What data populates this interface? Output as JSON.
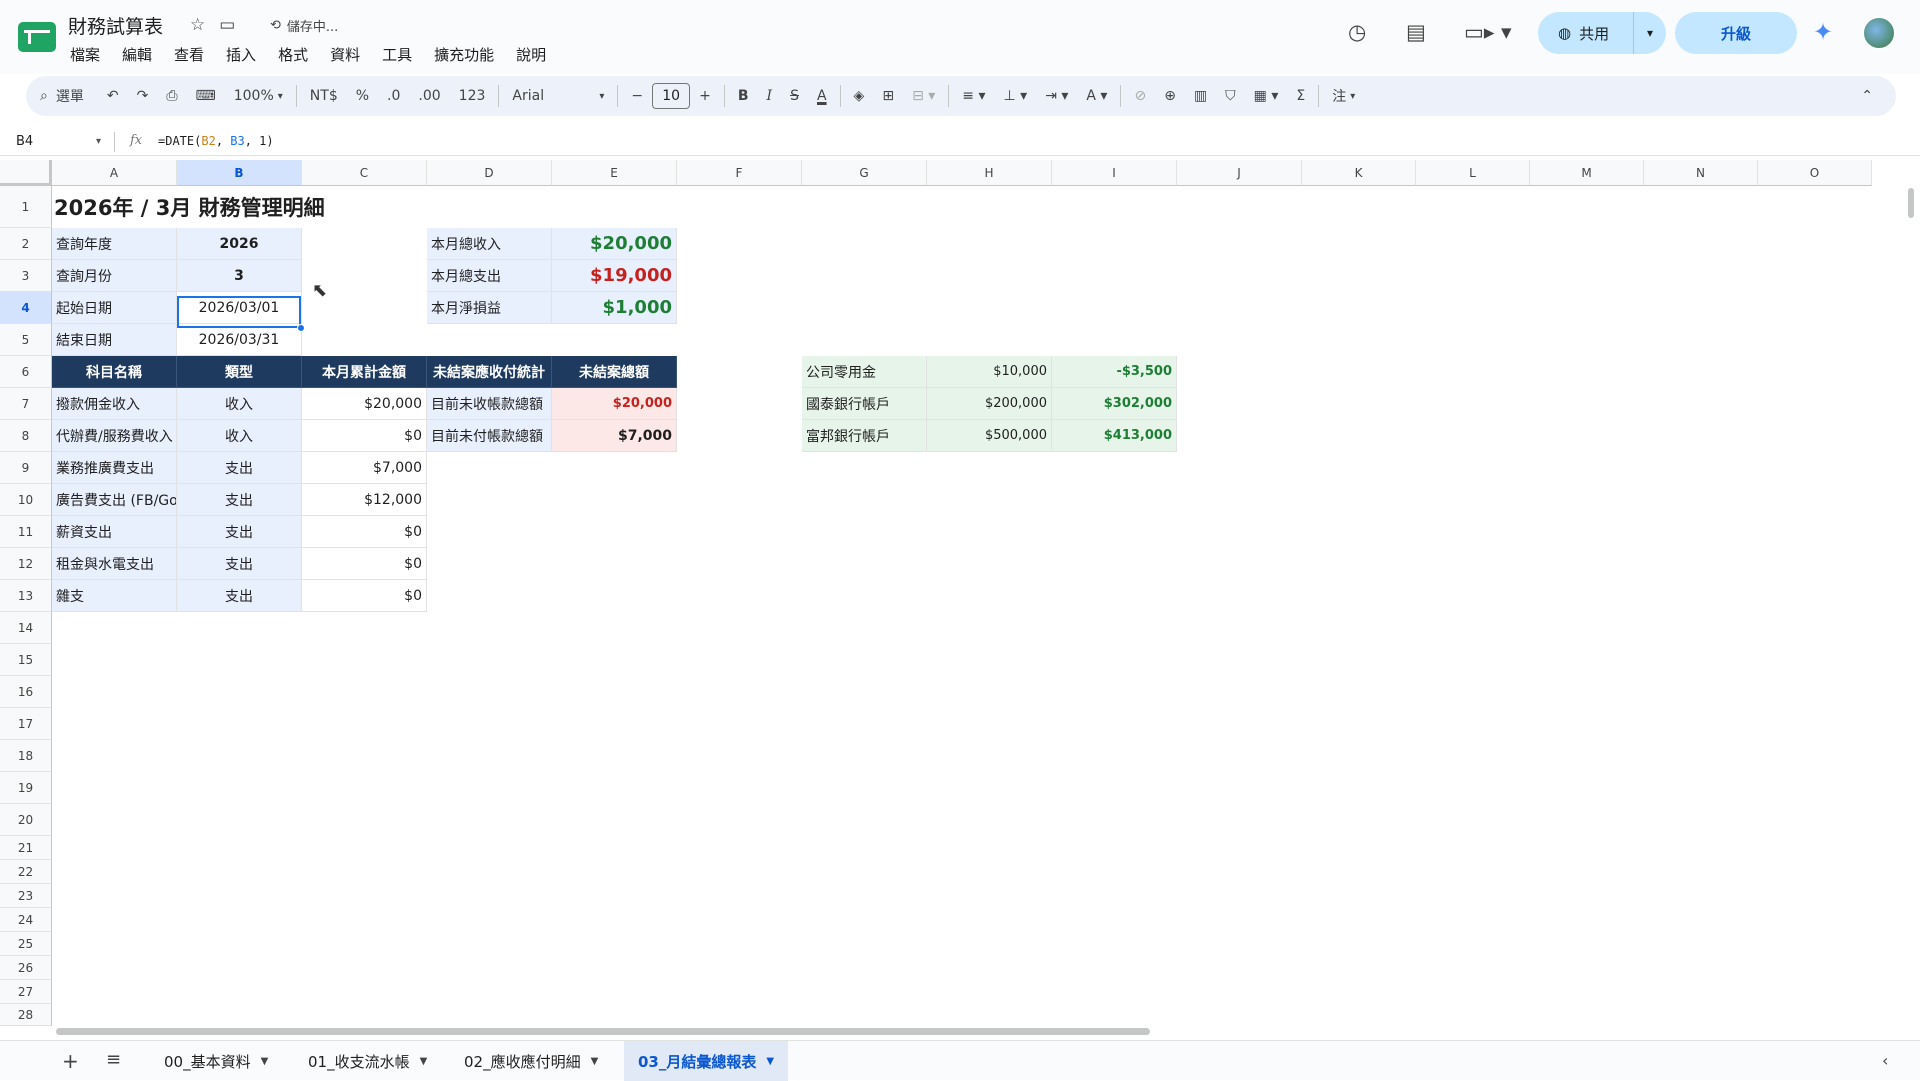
{
  "app": {
    "doc_title": "財務試算表",
    "saving_status": "儲存中...",
    "menus": [
      "檔案",
      "編輯",
      "查看",
      "插入",
      "格式",
      "資料",
      "工具",
      "擴充功能",
      "說明"
    ],
    "share_label": "共用",
    "upgrade_label": "升級"
  },
  "toolbar": {
    "search_label": "選單",
    "zoom": "100%",
    "currency": "NT$",
    "percent": "%",
    "dec_decrease": ".0",
    "dec_increase": ".00",
    "number_format": "123",
    "font": "Arial",
    "font_size": "10",
    "bold": "B",
    "italic": "I",
    "strike": "S",
    "text_color": "A",
    "sum": "Σ",
    "notes": "注"
  },
  "formula_bar": {
    "name_box": "B4",
    "fx": "fx",
    "formula_prefix": "=DATE(",
    "ref1": "B2",
    "sep1": ", ",
    "ref2": "B3",
    "formula_suffix": ", 1)"
  },
  "columns": [
    "A",
    "B",
    "C",
    "D",
    "E",
    "F",
    "G",
    "H",
    "I",
    "J",
    "K",
    "L",
    "M",
    "N",
    "O"
  ],
  "rows": [
    "1",
    "2",
    "3",
    "4",
    "5",
    "6",
    "7",
    "8",
    "9",
    "10",
    "11",
    "12",
    "13",
    "14",
    "15",
    "16",
    "17",
    "18",
    "19",
    "20",
    "21",
    "22",
    "23",
    "24",
    "25",
    "26",
    "27",
    "28"
  ],
  "sheet": {
    "title": "2026年 / 3月 財務管理明細",
    "query": [
      {
        "label": "查詢年度",
        "value": "2026"
      },
      {
        "label": "查詢月份",
        "value": "3"
      },
      {
        "label": "起始日期",
        "value": "2026/03/01"
      },
      {
        "label": "結束日期",
        "value": "2026/03/31"
      }
    ],
    "summary": [
      {
        "label": "本月總收入",
        "value": "$20,000"
      },
      {
        "label": "本月總支出",
        "value": "$19,000"
      },
      {
        "label": "本月淨損益",
        "value": "$1,000"
      }
    ],
    "table_headers": [
      "科目名稱",
      "類型",
      "本月累計金額",
      "未結案應收付統計",
      "未結案總額"
    ],
    "items": [
      {
        "name": "撥款佣金收入",
        "type": "收入",
        "amount": "$20,000"
      },
      {
        "name": "代辦費/服務費收入",
        "type": "收入",
        "amount": "$0"
      },
      {
        "name": "業務推廣費支出",
        "type": "支出",
        "amount": "$7,000"
      },
      {
        "name": "廣告費支出 (FB/Google)",
        "type": "支出",
        "amount": "$12,000"
      },
      {
        "name": "薪資支出",
        "type": "支出",
        "amount": "$0"
      },
      {
        "name": "租金與水電支出",
        "type": "支出",
        "amount": "$0"
      },
      {
        "name": "雜支",
        "type": "支出",
        "amount": "$0"
      }
    ],
    "pending": [
      {
        "label": "目前未收帳款總額",
        "value": "$20,000"
      },
      {
        "label": "目前未付帳款總額",
        "value": "$7,000"
      }
    ],
    "accounts": [
      {
        "name": "公司零用金",
        "balance": "$10,000",
        "change": "-$3,500"
      },
      {
        "name": "國泰銀行帳戶",
        "balance": "$200,000",
        "change": "$302,000"
      },
      {
        "name": "富邦銀行帳戶",
        "balance": "$500,000",
        "change": "$413,000"
      }
    ]
  },
  "sheet_tabs": [
    "00_基本資料",
    "01_收支流水帳",
    "02_應收應付明細",
    "03_月結彙總報表"
  ],
  "colors": {
    "accent": "#1a73e8",
    "header_dark": "#1e3a5f",
    "positive": "#1e7e34",
    "negative": "#c5221f"
  }
}
